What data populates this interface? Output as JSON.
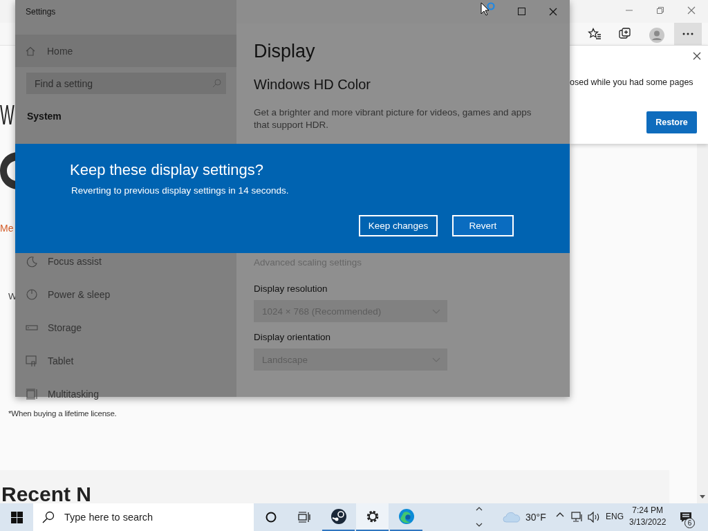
{
  "browser": {
    "notification": {
      "message": "osed while you had some pages",
      "button": "Restore"
    },
    "page": {
      "heading_fragment": "W",
      "link_fragment": "Me",
      "text_fragment": "W",
      "footnote": "*When buying a lifetime license.",
      "section_heading": "Recent N"
    }
  },
  "settings": {
    "title": "Settings",
    "sidebar": {
      "home": "Home",
      "search_placeholder": "Find a setting",
      "section": "System",
      "items": [
        {
          "kind": "focus",
          "label": "Focus assist"
        },
        {
          "kind": "power",
          "label": "Power & sleep"
        },
        {
          "kind": "storage",
          "label": "Storage"
        },
        {
          "kind": "tablet",
          "label": "Tablet"
        },
        {
          "kind": "multitasking",
          "label": "Multitasking"
        }
      ]
    },
    "content": {
      "title": "Display",
      "subtitle": "Windows HD Color",
      "description": "Get a brighter and more vibrant picture for videos, games and apps that support HDR.",
      "link": "Advanced scaling settings",
      "fields": [
        {
          "label": "Display resolution",
          "value": "1024 × 768 (Recommended)"
        },
        {
          "label": "Display orientation",
          "value": "Landscape"
        }
      ]
    }
  },
  "dialog": {
    "title": "Keep these display settings?",
    "message": "Reverting to previous display settings in 14 seconds.",
    "buttons": [
      "Keep changes",
      "Revert"
    ]
  },
  "taskbar": {
    "search_placeholder": "Type here to search",
    "apps": [
      {
        "kind": "steam",
        "active": false
      },
      {
        "kind": "settings",
        "active": true
      },
      {
        "kind": "edge",
        "active": false
      }
    ],
    "weather": "30°F",
    "language": "ENG",
    "time": "7:24 PM",
    "date": "3/13/2022",
    "notifications": "6"
  }
}
